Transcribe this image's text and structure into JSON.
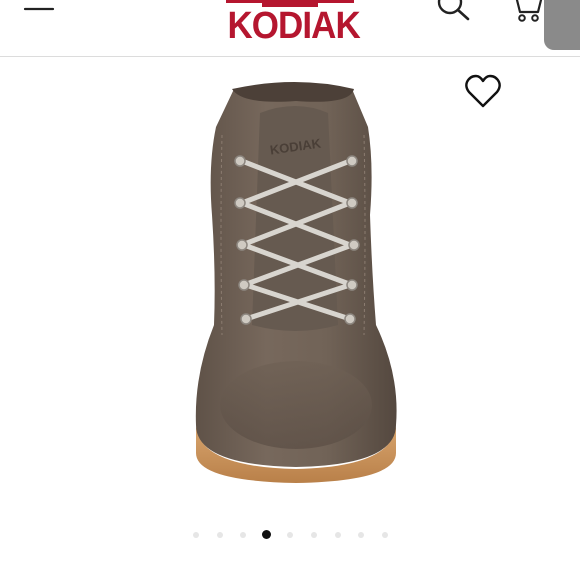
{
  "header": {
    "brand_name": "KODIAK",
    "brand_color": "#b5162f",
    "menu_icon": "hamburger-menu-icon",
    "search_icon": "search-icon",
    "cart_icon": "shopping-cart-icon"
  },
  "product": {
    "image_subject": "brown-nubuck-lace-up-boot",
    "wishlist_icon": "heart-outline-icon",
    "embossed_logo": "KODIAK"
  },
  "carousel": {
    "dot_count": 9,
    "active_index": 3
  }
}
